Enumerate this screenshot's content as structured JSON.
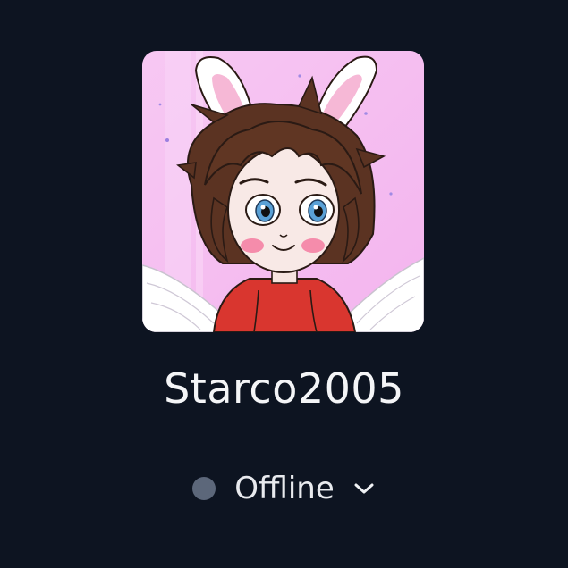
{
  "profile": {
    "username": "Starco2005",
    "avatar_alt": "avatar image"
  },
  "status": {
    "label": "Offline",
    "dot_color": "#5c677a",
    "chevron_icon": "chevron-down-icon"
  },
  "colors": {
    "background": "#0d1421",
    "text": "#f4f5f7"
  }
}
